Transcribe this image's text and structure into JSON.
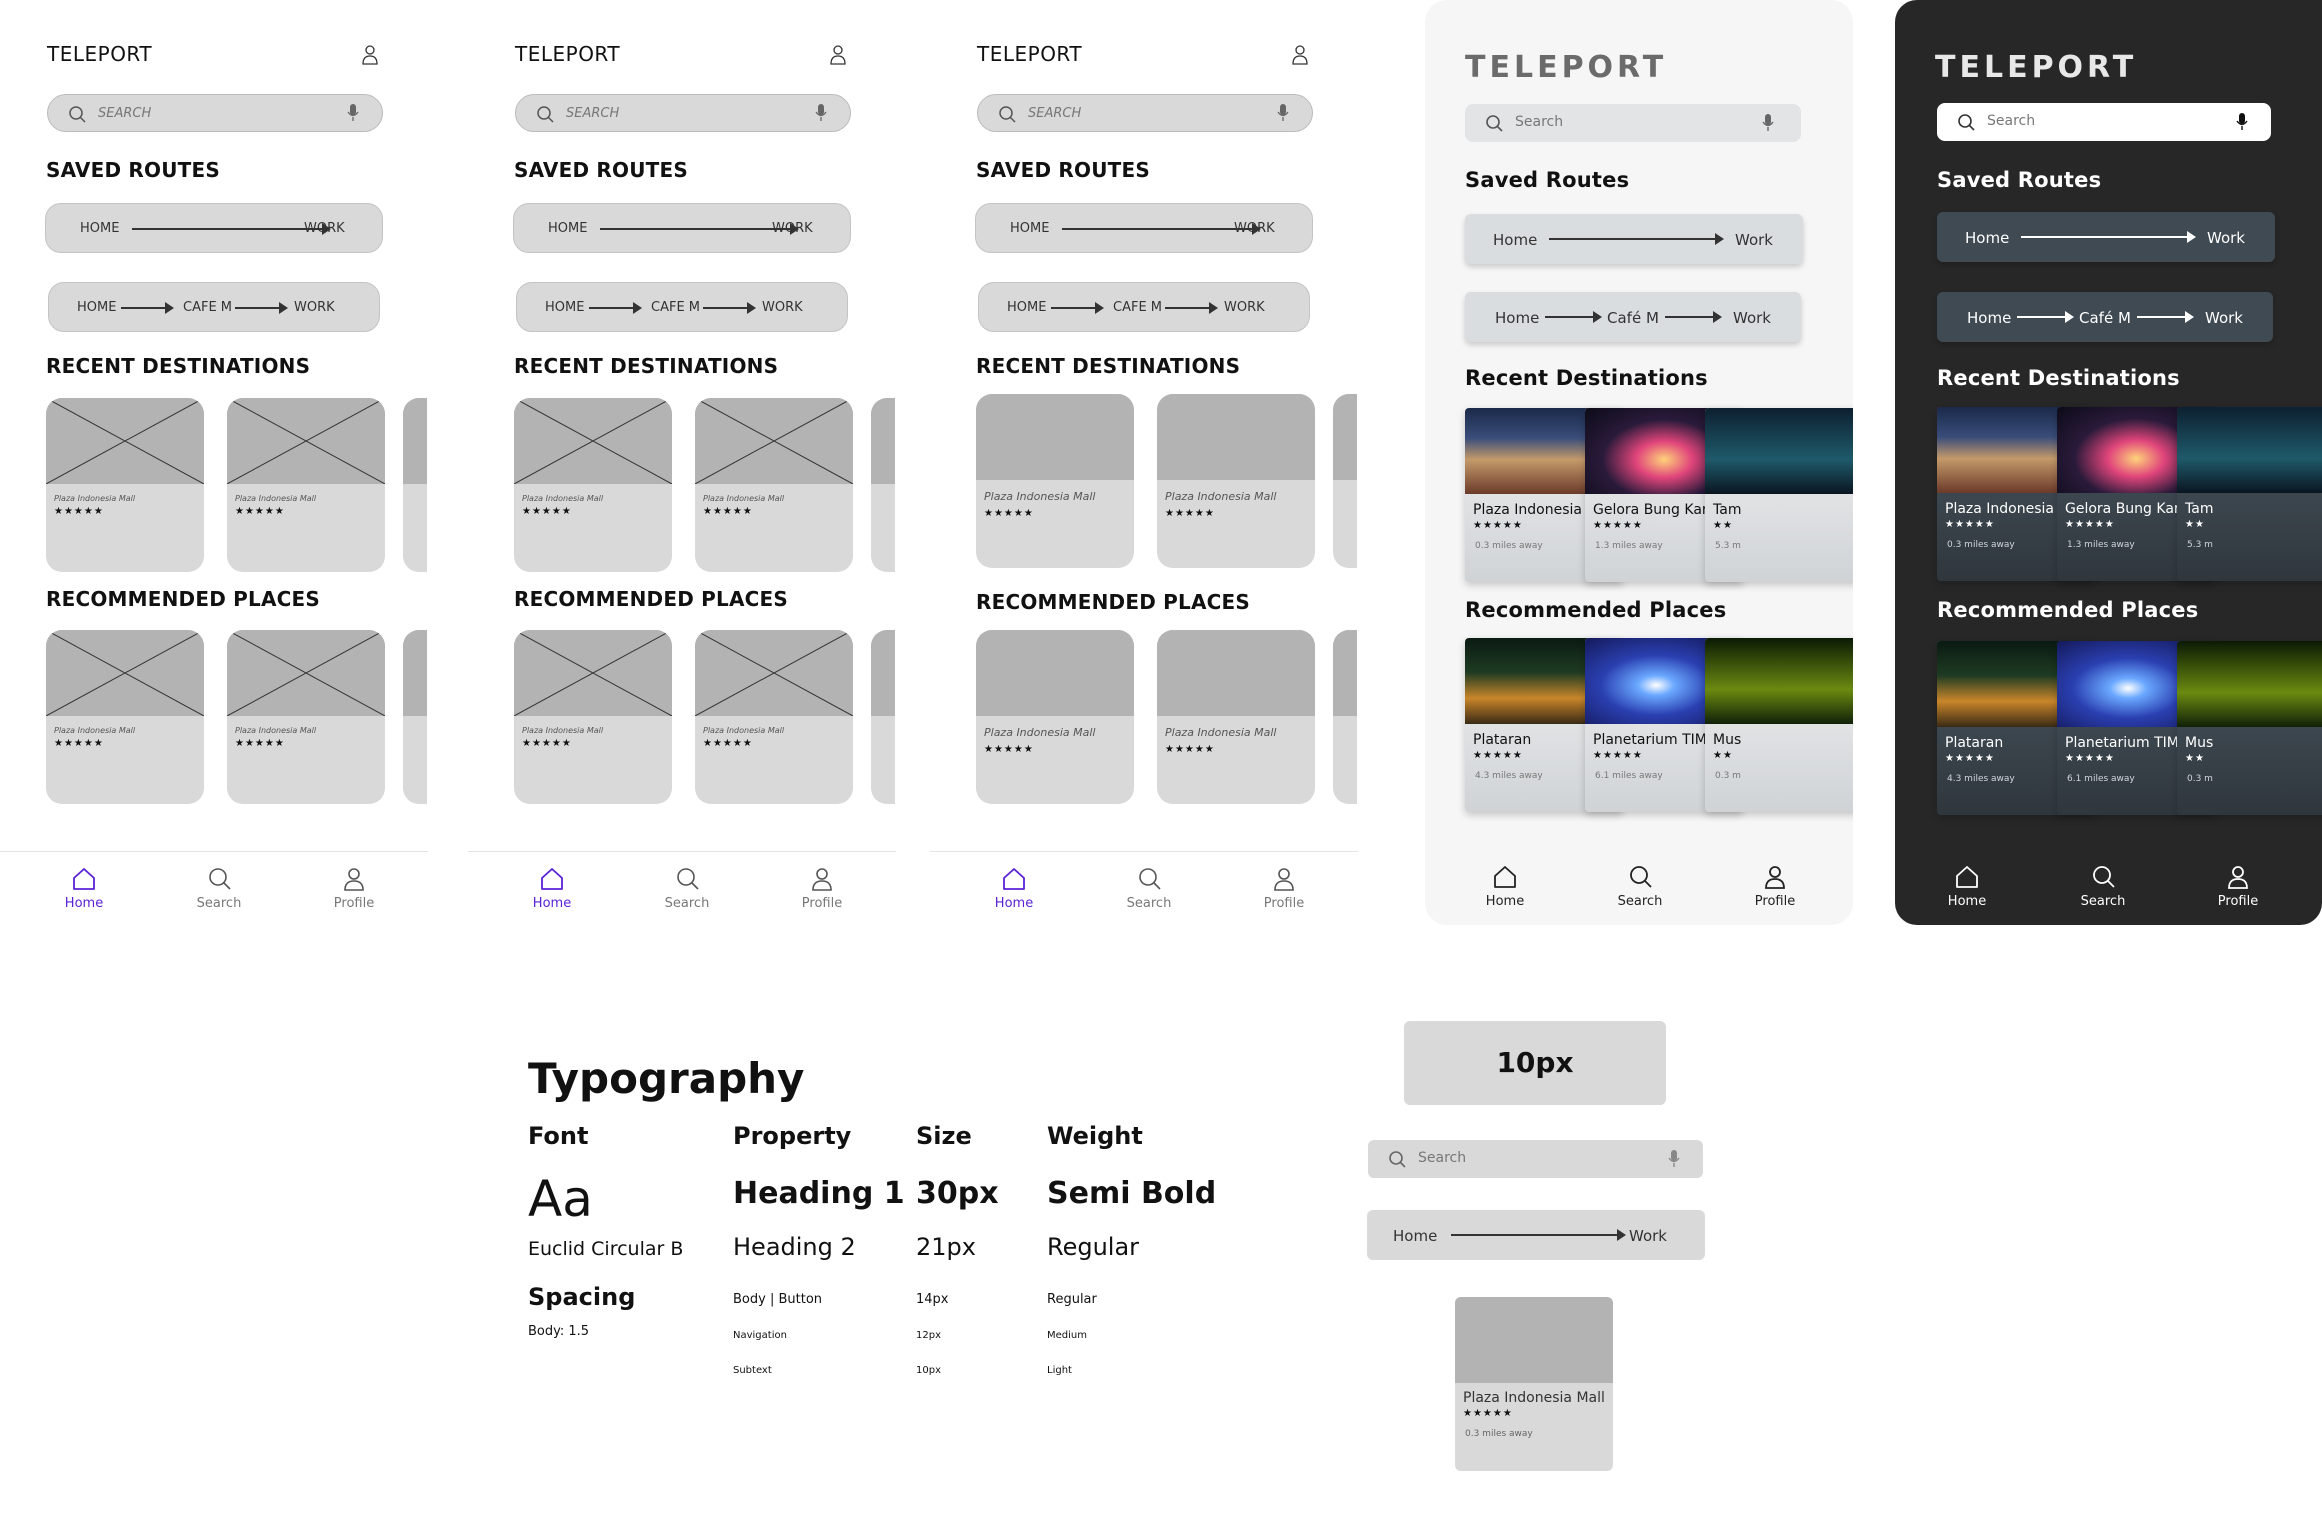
{
  "wireframes": {
    "title": "TELEPORT",
    "search_placeholder": "SEARCH",
    "saved_routes_heading": "SAVED ROUTES",
    "route1": {
      "from": "HOME",
      "to": "WORK"
    },
    "route2": {
      "from": "HOME",
      "via": "CAFE M",
      "to": "WORK"
    },
    "recent_heading": "RECENT DESTINATIONS",
    "recommended_heading": "RECOMMENDED PLACES",
    "card_name": "Plaza Indonesia Mall",
    "card_stars": "★★★★★",
    "nav": {
      "home": "Home",
      "search": "Search",
      "profile": "Profile"
    }
  },
  "light": {
    "title": "TELEPORT",
    "search_placeholder": "Search",
    "saved_routes_heading": "Saved Routes",
    "route1": {
      "from": "Home",
      "to": "Work"
    },
    "route2": {
      "from": "Home",
      "via": "Café M",
      "to": "Work"
    },
    "recent_heading": "Recent Destinations",
    "recent": [
      {
        "name": "Plaza Indonesia Mall",
        "stars": "★★★★★",
        "distance": "0.3 miles away"
      },
      {
        "name": "Gelora Bung Karno",
        "stars": "★★★★★",
        "distance": "1.3 miles away"
      },
      {
        "name": "Tam",
        "stars": "★★",
        "distance": "5.3 m"
      }
    ],
    "recommended_heading": "Recommended Places",
    "recommended": [
      {
        "name": "Plataran",
        "stars": "★★★★★",
        "distance": "4.3 miles away"
      },
      {
        "name": "Planetarium TIM",
        "stars": "★★★★★",
        "distance": "6.1 miles away"
      },
      {
        "name": "Mus",
        "stars": "★★",
        "distance": "0.3 m"
      }
    ],
    "nav": {
      "home": "Home",
      "search": "Search",
      "profile": "Profile"
    }
  },
  "dark": {
    "title": "TELEPORT",
    "search_placeholder": "Search",
    "saved_routes_heading": "Saved Routes",
    "route1": {
      "from": "Home",
      "to": "Work"
    },
    "route2": {
      "from": "Home",
      "via": "Café M",
      "to": "Work"
    },
    "recent_heading": "Recent Destinations",
    "recent": [
      {
        "name": "Plaza Indonesia Mall",
        "stars": "★★★★★",
        "distance": "0.3 miles away"
      },
      {
        "name": "Gelora Bung Karno",
        "stars": "★★★★★",
        "distance": "1.3 miles away"
      },
      {
        "name": "Tam",
        "stars": "★★",
        "distance": "5.3 m"
      }
    ],
    "recommended_heading": "Recommended Places",
    "recommended": [
      {
        "name": "Plataran",
        "stars": "★★★★★",
        "distance": "4.3 miles away"
      },
      {
        "name": "Planetarium TIM",
        "stars": "★★★★★",
        "distance": "6.1 miles away"
      },
      {
        "name": "Mus",
        "stars": "★★",
        "distance": "0.3 m"
      }
    ],
    "nav": {
      "home": "Home",
      "search": "Search",
      "profile": "Profile"
    }
  },
  "typography": {
    "heading": "Typography",
    "col_font": "Font",
    "col_property": "Property",
    "col_size": "Size",
    "col_weight": "Weight",
    "sample": "Aa",
    "font_name": "Euclid Circular B",
    "spacing_heading": "Spacing",
    "spacing_value": "Body: 1.5",
    "rows": [
      {
        "property": "Heading 1",
        "size": "30px",
        "weight": "Semi Bold"
      },
      {
        "property": "Heading 2",
        "size": "21px",
        "weight": "Regular"
      },
      {
        "property": "Body | Button",
        "size": "14px",
        "weight": "Regular"
      },
      {
        "property": "Navigation",
        "size": "12px",
        "weight": "Medium"
      },
      {
        "property": "Subtext",
        "size": "10px",
        "weight": "Light"
      }
    ]
  },
  "components": {
    "radius_label": "10px",
    "search_placeholder": "Search",
    "route": {
      "from": "Home",
      "to": "Work"
    },
    "card": {
      "name": "Plaza Indonesia Mall",
      "stars": "★★★★★",
      "distance": "0.3 miles away"
    }
  },
  "colors": {
    "accent": "#5a22d6",
    "dark_bg": "#272727",
    "light_bg": "#f6f6f6",
    "wire_gray": "#d9d9d9"
  }
}
